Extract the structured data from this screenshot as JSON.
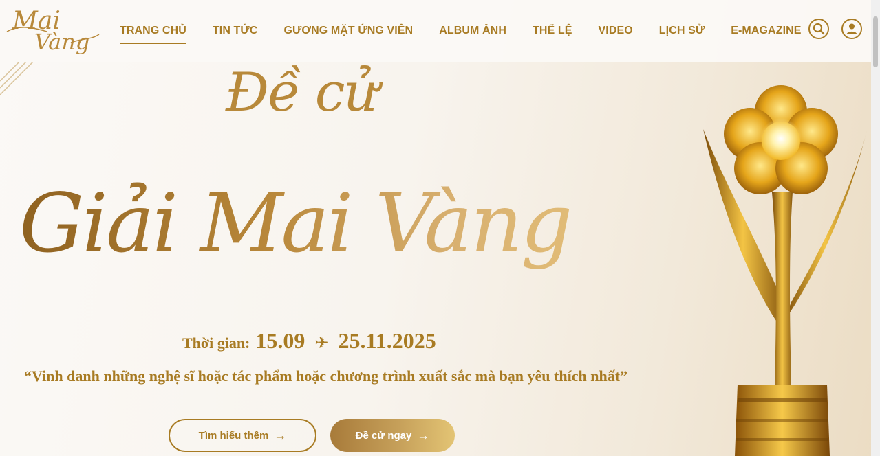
{
  "header": {
    "logo_text": "Mai Vàng",
    "nav": [
      {
        "label": "TRANG CHỦ",
        "active": true
      },
      {
        "label": "TIN TỨC"
      },
      {
        "label": "GƯƠNG MẶT ỨNG VIÊN"
      },
      {
        "label": "ALBUM ẢNH"
      },
      {
        "label": "THỂ LỆ"
      },
      {
        "label": "VIDEO"
      },
      {
        "label": "LỊCH SỬ"
      },
      {
        "label": "E-MAGAZINE"
      }
    ],
    "search_icon": "search-icon",
    "user_icon": "user-icon"
  },
  "hero": {
    "kicker": "Đề cử",
    "headline": "Giải Mai Vàng",
    "time_label": "Thời gian:",
    "time_start": "15.09",
    "time_arrow": "✈",
    "time_end": "25.11.2025",
    "quote": "“Vinh danh những nghệ sĩ hoặc tác phẩm hoặc chương trình xuất sắc mà bạn yêu thích nhất”",
    "btn_learn": "Tìm hiểu thêm",
    "btn_nominate": "Đề cử ngay",
    "arrow": "→"
  },
  "colors": {
    "gold": "#a87b23",
    "gold_light": "#e3c474",
    "bg": "#f8f4ee"
  }
}
